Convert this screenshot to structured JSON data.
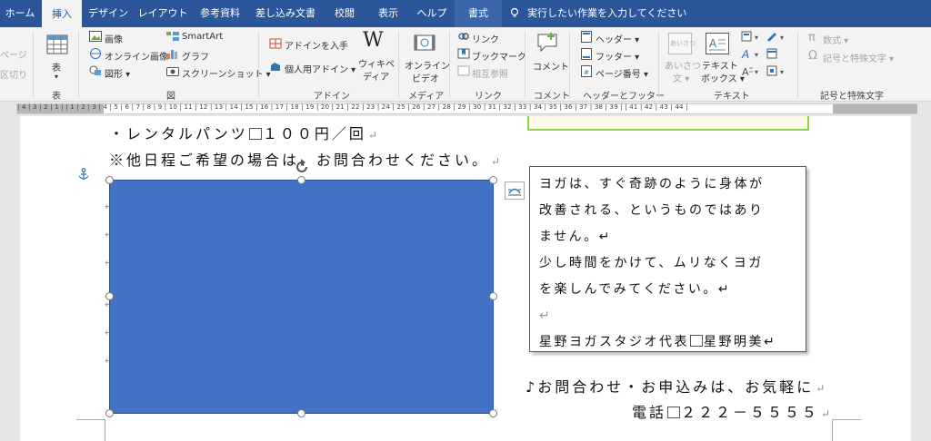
{
  "tabs": [
    {
      "label": "ホーム"
    },
    {
      "label": "挿入",
      "active": true
    },
    {
      "label": "デザイン"
    },
    {
      "label": "レイアウト"
    },
    {
      "label": "参考資料"
    },
    {
      "label": "差し込み文書"
    },
    {
      "label": "校閲"
    },
    {
      "label": "表示"
    },
    {
      "label": "ヘルプ"
    },
    {
      "label": "書式",
      "contextual": true
    }
  ],
  "tell_me": "実行したい作業を入力してください",
  "ribbon": {
    "pages": {
      "page_label": "ページ",
      "break_label": "区切り",
      "group_label": ""
    },
    "table": {
      "label": "表",
      "group_label": "表"
    },
    "illustrations": {
      "picture": "画像",
      "online_picture": "オンライン画像",
      "shapes": "図形",
      "smartart": "SmartArt",
      "chart": "グラフ",
      "screenshot": "スクリーンショット",
      "group_label": "図"
    },
    "addins": {
      "get_addins": "アドインを入手",
      "my_addins": "個人用アドイン",
      "wikipedia_line1": "ウィキペ",
      "wikipedia_line2": "ディア",
      "group_label": "アドイン"
    },
    "media": {
      "online_video_line1": "オンライン",
      "online_video_line2": "ビデオ",
      "group_label": "メディア"
    },
    "links": {
      "link": "リンク",
      "bookmark": "ブックマーク",
      "cross_ref": "相互参照",
      "group_label": "リンク"
    },
    "comments": {
      "comment": "コメント",
      "group_label": "コメント"
    },
    "header_footer": {
      "header": "ヘッダー",
      "footer": "フッター",
      "page_number": "ページ番号",
      "group_label": "ヘッダーとフッター"
    },
    "text": {
      "greeting_line1": "あいさつ",
      "greeting_line2": "文",
      "textbox_line1": "テキスト",
      "textbox_line2": "ボックス",
      "group_label": "テキスト"
    },
    "symbols": {
      "equation": "数式",
      "symbol": "記号と特殊文字",
      "group_label": "記号と特殊文字"
    }
  },
  "ruler": {
    "text": "| 4 | 3 | 2 | 1 |     | 1 | 2 | 3 | 4 | 5 | 6 | 7 | 8 | 9 | 10 | 11 | 12 | 13 | 14 | 15 | 16 | 17 | 18 | 19 | 20 | 21 | 22 | 23 | 24 | 25 | 26 | 27 | 28 | 29 | 30 | 31 | 32 | 33 | 34 | 35 | 36 | 37 | 38 | 39 |     | 41 | 42 | 43 | 44 |"
  },
  "document": {
    "line1_a": "・レンタルパンツ",
    "line1_b": "１００円／回",
    "line2": "※他日程ご希望の場合は、お問合わせください。",
    "contact": "♪お問合わせ・お申込みは、お気軽に",
    "phone_label": "電話",
    "phone_number": "２２２－５５５５",
    "return_mark": "↵"
  },
  "textbox": {
    "lines": [
      "ヨガは、すぐ奇跡のように身体が",
      "改善される、というものではあり",
      "ません。↵",
      "少し時間をかけて、ムリなくヨガ",
      "を楽しんでみてください。↵",
      "↵"
    ],
    "signature_a": "星野ヨガスタジオ代表",
    "signature_b": "星野明美↵"
  },
  "colors": {
    "title_bar": "#2b579a",
    "shape_fill": "#4472c4",
    "picture_border": "#92d050"
  }
}
